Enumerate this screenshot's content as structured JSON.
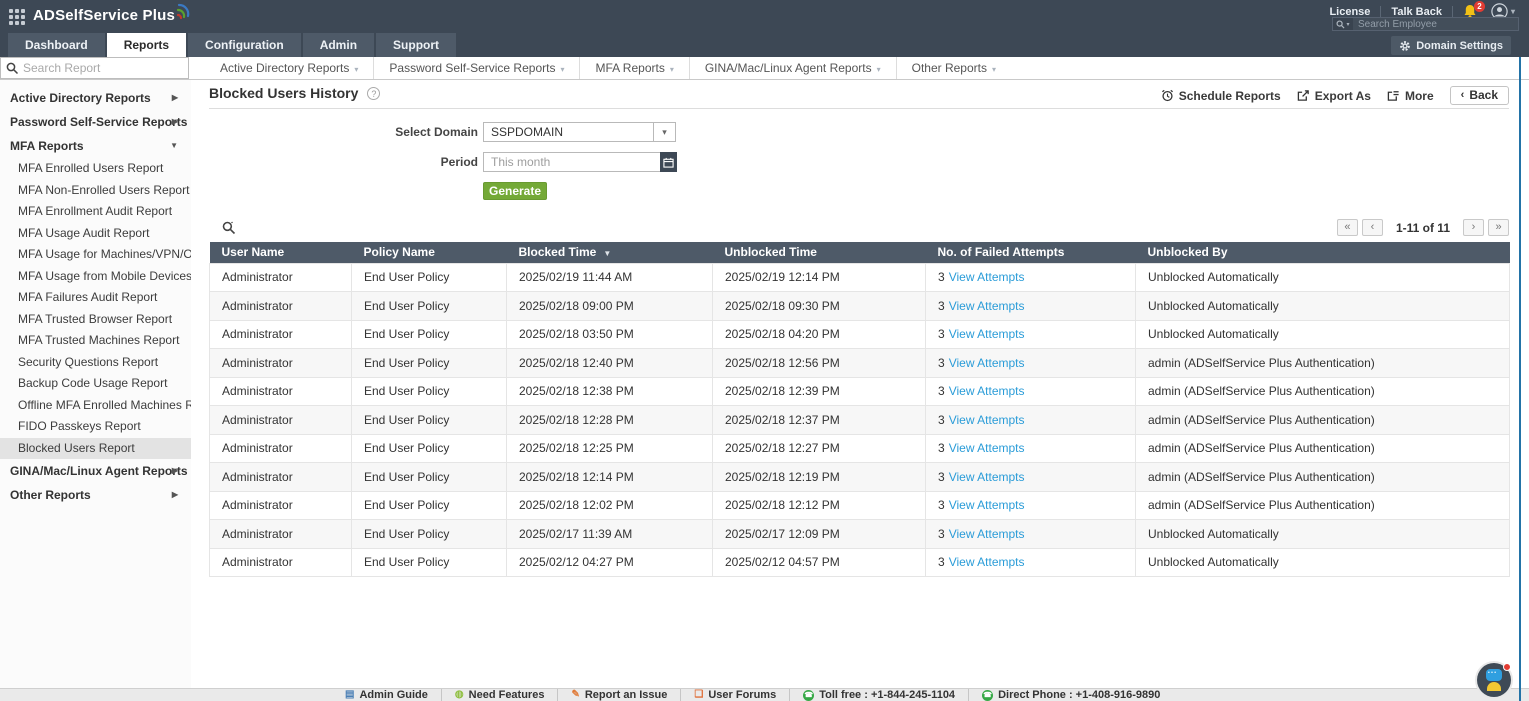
{
  "brand": {
    "logo_text": "ADSelfService Plus"
  },
  "topbar": {
    "license": "License",
    "talk_back": "Talk Back",
    "notification_count": "2",
    "search_employee_placeholder": "Search Employee",
    "domain_settings_label": "Domain Settings"
  },
  "tabs": [
    {
      "label": "Dashboard",
      "active": false
    },
    {
      "label": "Reports",
      "active": true
    },
    {
      "label": "Configuration",
      "active": false
    },
    {
      "label": "Admin",
      "active": false
    },
    {
      "label": "Support",
      "active": false
    }
  ],
  "report_search": {
    "placeholder": "Search Report"
  },
  "secondary_nav": [
    "Active Directory Reports",
    "Password Self-Service Reports",
    "MFA Reports",
    "GINA/Mac/Linux Agent Reports",
    "Other Reports"
  ],
  "sidebar": {
    "selected_item": "Blocked Users Report",
    "sections": [
      {
        "label": "Active Directory Reports",
        "expanded": false,
        "items": []
      },
      {
        "label": "Password Self-Service Reports",
        "expanded": false,
        "items": []
      },
      {
        "label": "MFA Reports",
        "expanded": true,
        "items": [
          "MFA Enrolled Users Report",
          "MFA Non-Enrolled Users Report",
          "MFA Enrollment Audit Report",
          "MFA Usage Audit Report",
          "MFA Usage for Machines/VPN/OWA",
          "MFA Usage from Mobile Devices",
          "MFA Failures Audit Report",
          "MFA Trusted Browser Report",
          "MFA Trusted Machines Report",
          "Security Questions Report",
          "Backup Code Usage Report",
          "Offline MFA Enrolled Machines Report",
          "FIDO Passkeys Report",
          "Blocked Users Report"
        ]
      },
      {
        "label": "GINA/Mac/Linux Agent Reports",
        "expanded": false,
        "items": []
      },
      {
        "label": "Other Reports",
        "expanded": false,
        "items": []
      }
    ]
  },
  "main": {
    "title": "Blocked Users History",
    "actions": {
      "schedule": "Schedule Reports",
      "export_as": "Export As",
      "more": "More",
      "back": "Back"
    },
    "form": {
      "domain_label": "Select Domain",
      "domain_value": "SSPDOMAIN",
      "period_label": "Period",
      "period_placeholder": "This month",
      "generate_label": "Generate"
    },
    "pagination": {
      "first": "«",
      "prev": "‹",
      "range_text": "1-11 of 11",
      "next": "›",
      "last": "»"
    },
    "table": {
      "columns": [
        "User Name",
        "Policy Name",
        "Blocked Time",
        "Unblocked Time",
        "No. of Failed Attempts",
        "Unblocked By"
      ],
      "sorted_column": "Blocked Time",
      "view_attempts_label": "View Attempts",
      "rows": [
        {
          "user": "Administrator",
          "policy": "End User Policy",
          "blocked": "2025/02/19 11:44 AM",
          "unblocked": "2025/02/19 12:14 PM",
          "attempts": "3",
          "unblocked_by": "Unblocked Automatically"
        },
        {
          "user": "Administrator",
          "policy": "End User Policy",
          "blocked": "2025/02/18 09:00 PM",
          "unblocked": "2025/02/18 09:30 PM",
          "attempts": "3",
          "unblocked_by": "Unblocked Automatically"
        },
        {
          "user": "Administrator",
          "policy": "End User Policy",
          "blocked": "2025/02/18 03:50 PM",
          "unblocked": "2025/02/18 04:20 PM",
          "attempts": "3",
          "unblocked_by": "Unblocked Automatically"
        },
        {
          "user": "Administrator",
          "policy": "End User Policy",
          "blocked": "2025/02/18 12:40 PM",
          "unblocked": "2025/02/18 12:56 PM",
          "attempts": "3",
          "unblocked_by": "admin (ADSelfService Plus Authentication)"
        },
        {
          "user": "Administrator",
          "policy": "End User Policy",
          "blocked": "2025/02/18 12:38 PM",
          "unblocked": "2025/02/18 12:39 PM",
          "attempts": "3",
          "unblocked_by": "admin (ADSelfService Plus Authentication)"
        },
        {
          "user": "Administrator",
          "policy": "End User Policy",
          "blocked": "2025/02/18 12:28 PM",
          "unblocked": "2025/02/18 12:37 PM",
          "attempts": "3",
          "unblocked_by": "admin (ADSelfService Plus Authentication)"
        },
        {
          "user": "Administrator",
          "policy": "End User Policy",
          "blocked": "2025/02/18 12:25 PM",
          "unblocked": "2025/02/18 12:27 PM",
          "attempts": "3",
          "unblocked_by": "admin (ADSelfService Plus Authentication)"
        },
        {
          "user": "Administrator",
          "policy": "End User Policy",
          "blocked": "2025/02/18 12:14 PM",
          "unblocked": "2025/02/18 12:19 PM",
          "attempts": "3",
          "unblocked_by": "admin (ADSelfService Plus Authentication)"
        },
        {
          "user": "Administrator",
          "policy": "End User Policy",
          "blocked": "2025/02/18 12:02 PM",
          "unblocked": "2025/02/18 12:12 PM",
          "attempts": "3",
          "unblocked_by": "admin (ADSelfService Plus Authentication)"
        },
        {
          "user": "Administrator",
          "policy": "End User Policy",
          "blocked": "2025/02/17 11:39 AM",
          "unblocked": "2025/02/17 12:09 PM",
          "attempts": "3",
          "unblocked_by": "Unblocked Automatically"
        },
        {
          "user": "Administrator",
          "policy": "End User Policy",
          "blocked": "2025/02/12 04:27 PM",
          "unblocked": "2025/02/12 04:57 PM",
          "attempts": "3",
          "unblocked_by": "Unblocked Automatically"
        }
      ]
    }
  },
  "footer": {
    "links": [
      {
        "label": "Admin Guide",
        "icon": "admin-guide-icon",
        "style": "book"
      },
      {
        "label": "Need Features",
        "icon": "need-features-icon",
        "style": "bulb"
      },
      {
        "label": "Report an Issue",
        "icon": "report-issue-icon",
        "style": "pencil"
      },
      {
        "label": "User Forums",
        "icon": "user-forums-icon",
        "style": "forum"
      },
      {
        "label": "Toll free : +1-844-245-1104",
        "icon": "phone-icon",
        "style": "phone"
      },
      {
        "label": "Direct Phone : +1-408-916-9890",
        "icon": "phone-icon",
        "style": "phone"
      }
    ]
  },
  "colors": {
    "header_dark": "#3d4855",
    "table_header": "#4e5a68",
    "accent_green": "#74a937",
    "link_blue": "#2a9cd8",
    "notification_red": "#e23c33",
    "right_edge_blue": "#2373a7"
  }
}
